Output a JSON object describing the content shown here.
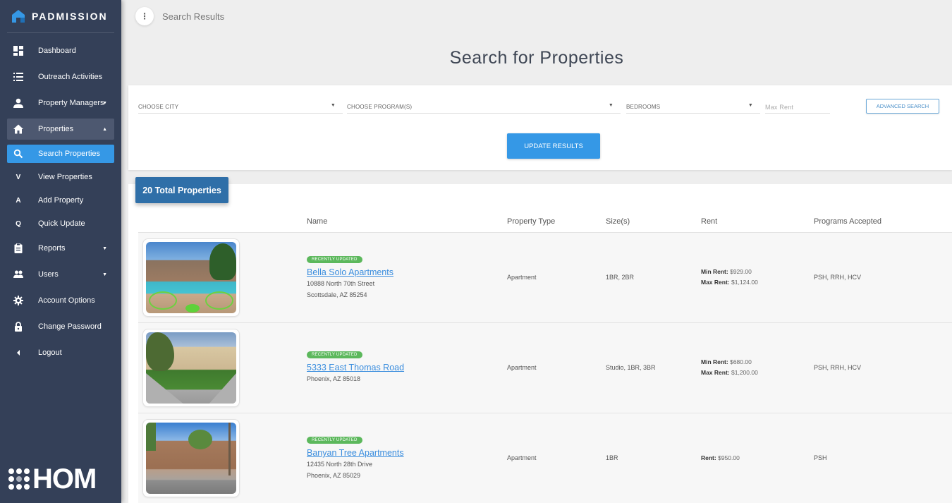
{
  "brand": {
    "name": "PADMISSION",
    "footer_logo": "HOM"
  },
  "sidebar": {
    "items": [
      {
        "label": "Dashboard",
        "icon": "dashboard-icon"
      },
      {
        "label": "Outreach Activities",
        "icon": "list-icon"
      },
      {
        "label": "Property Managers",
        "icon": "person-icon",
        "caret": "▼"
      },
      {
        "label": "Properties",
        "icon": "home-icon",
        "caret": "▲"
      },
      {
        "label": "Search Properties",
        "icon": "search-icon"
      },
      {
        "label": "View Properties",
        "letter": "V"
      },
      {
        "label": "Add Property",
        "letter": "A"
      },
      {
        "label": "Quick Update",
        "letter": "Q"
      },
      {
        "label": "Reports",
        "icon": "clipboard-icon",
        "caret": "▼"
      },
      {
        "label": "Users",
        "icon": "users-icon",
        "caret": "▼"
      },
      {
        "label": "Account Options",
        "icon": "gear-icon"
      },
      {
        "label": "Change Password",
        "icon": "lock-icon"
      },
      {
        "label": "Logout",
        "icon": "chevron-left-icon"
      }
    ]
  },
  "topbar": {
    "menu_icon": "⋮",
    "title": "Search Results"
  },
  "page": {
    "title": "Search for Properties"
  },
  "filters": {
    "city": "CHOOSE CITY",
    "programs": "CHOOSE PROGRAM(S)",
    "bedrooms": "BEDROOMS",
    "max_rent_placeholder": "Max Rent",
    "caret": "▼",
    "advanced_label": "ADVANCED SEARCH",
    "update_label": "UPDATE RESULTS"
  },
  "results": {
    "total_label": "20 Total Properties",
    "columns": [
      "Name",
      "Property Type",
      "Size(s)",
      "Rent",
      "Programs Accepted"
    ],
    "rows": [
      {
        "badge": "RECENTLY UPDATED",
        "name": "Bella Solo Apartments",
        "address1": "10888 North 70th Street",
        "address2": "Scottsdale, AZ 85254",
        "type": "Apartment",
        "sizes": "1BR, 2BR",
        "rent_label1": "Min Rent:",
        "rent_value1": "$929.00",
        "rent_label2": "Max Rent:",
        "rent_value2": "$1,124.00",
        "programs": "PSH, RRH, HCV"
      },
      {
        "badge": "RECENTLY UPDATED",
        "name": "5333 East Thomas Road",
        "address1": "Phoenix, AZ 85018",
        "address2": "",
        "type": "Apartment",
        "sizes": "Studio, 1BR, 3BR",
        "rent_label1": "Min Rent:",
        "rent_value1": "$680.00",
        "rent_label2": "Max Rent:",
        "rent_value2": "$1,200.00",
        "programs": "PSH, RRH, HCV"
      },
      {
        "badge": "RECENTLY UPDATED",
        "name": "Banyan Tree Apartments",
        "address1": "12435 North 28th Drive",
        "address2": "Phoenix, AZ 85029",
        "type": "Apartment",
        "sizes": "1BR",
        "rent_label1": "Rent:",
        "rent_value1": "$950.00",
        "rent_label2": "",
        "rent_value2": "",
        "programs": "PSH"
      }
    ]
  },
  "colors": {
    "sidebar_bg": "#344058",
    "active_blue": "#3598e6",
    "badge_green": "#5cb85c",
    "total_badge": "#2f6fa8",
    "link_blue": "#3a8dde"
  }
}
